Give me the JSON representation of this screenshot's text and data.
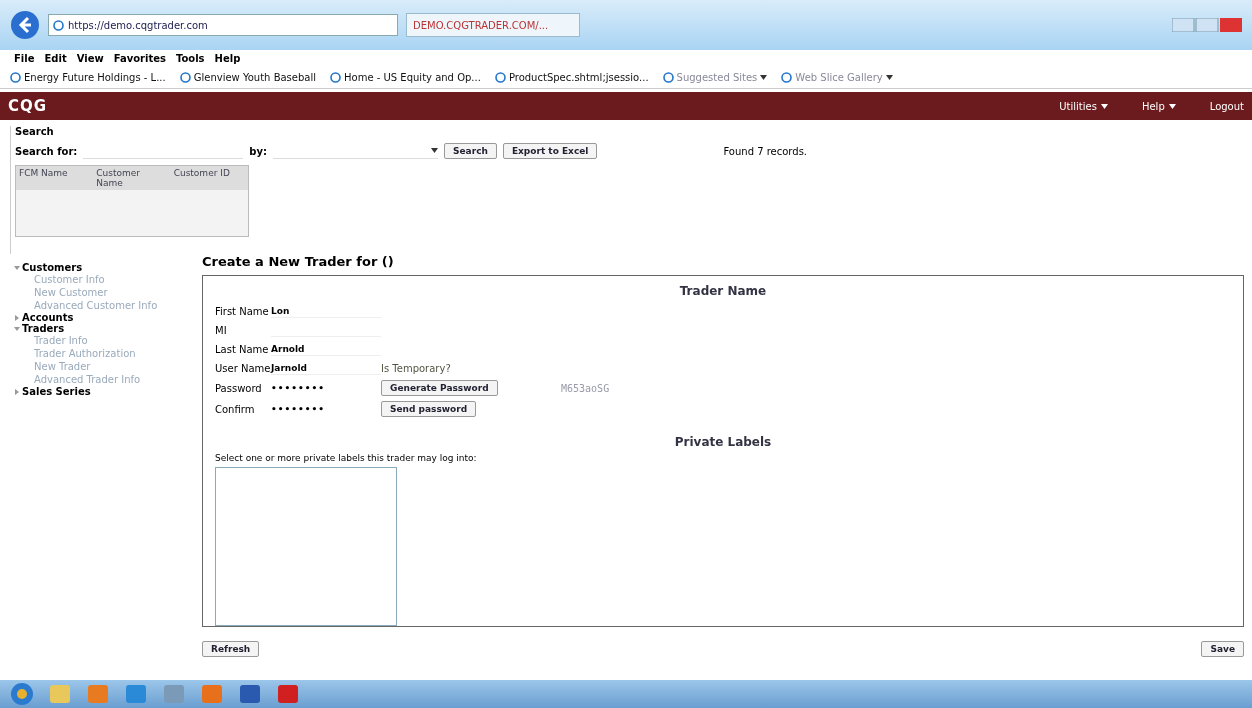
{
  "browser": {
    "address": "https://demo.cqgtrader.com",
    "tab_title": "DEMO.CQGTRADER.COM/...",
    "menu": [
      "File",
      "Edit",
      "View",
      "Favorites",
      "Tools",
      "Help"
    ],
    "favorites": [
      {
        "label": "Energy Future Holdings - L..."
      },
      {
        "label": "Glenview Youth Baseball"
      },
      {
        "label": "Home - US Equity and Op..."
      },
      {
        "label": "ProductSpec.shtml;jsessio..."
      },
      {
        "label": "Suggested Sites",
        "dropdown": true
      },
      {
        "label": "Web Slice Gallery",
        "dropdown": true
      }
    ]
  },
  "header": {
    "logo": "CQG",
    "nav": [
      {
        "label": "Utilities",
        "dropdown": true
      },
      {
        "label": "Help",
        "dropdown": true
      },
      {
        "label": "Logout",
        "dropdown": false
      }
    ]
  },
  "search": {
    "title": "Search",
    "search_for_label": "Search for:",
    "by_label": "by:",
    "buttons": [
      "Search",
      "Export to Excel"
    ],
    "found": "Found 7 records.",
    "columns": [
      "FCM Name",
      "Customer Name",
      "Customer ID"
    ]
  },
  "sidebar": [
    {
      "label": "Customers",
      "expanded": true,
      "children": [
        {
          "label": "Customer Info"
        },
        {
          "label": "New Customer"
        },
        {
          "label": "Advanced Customer Info"
        }
      ]
    },
    {
      "label": "Accounts",
      "expanded": false
    },
    {
      "label": "Traders",
      "expanded": true,
      "children": [
        {
          "label": "Trader Info"
        },
        {
          "label": "Trader Authorization"
        },
        {
          "label": "New Trader"
        },
        {
          "label": "Advanced Trader Info"
        }
      ]
    },
    {
      "label": "Sales Series",
      "expanded": false
    }
  ],
  "form": {
    "title": "Create a New Trader for ()",
    "section_title": "Trader Name",
    "fields": [
      {
        "label": "First Name",
        "value": "Lon",
        "kind": "text"
      },
      {
        "label": "MI",
        "kind": "text"
      },
      {
        "label": "Last Name",
        "value": "Arnold",
        "kind": "text"
      },
      {
        "label": "User Name",
        "value": "Jarnold",
        "kind": "text",
        "extra": "Is Temporary?"
      },
      {
        "label": "Password",
        "value": "••••••••",
        "kind": "password",
        "button": "Generate Password",
        "generated": "M653aoSG"
      },
      {
        "label": "Confirm",
        "value": "••••••••",
        "kind": "password",
        "button": "Send password"
      }
    ],
    "labels_title": "Private Labels",
    "labels_hint": "Select one or more private labels this trader may log into:"
  },
  "footer_buttons": [
    {
      "label": "Refresh"
    },
    {
      "label": "Save"
    }
  ]
}
